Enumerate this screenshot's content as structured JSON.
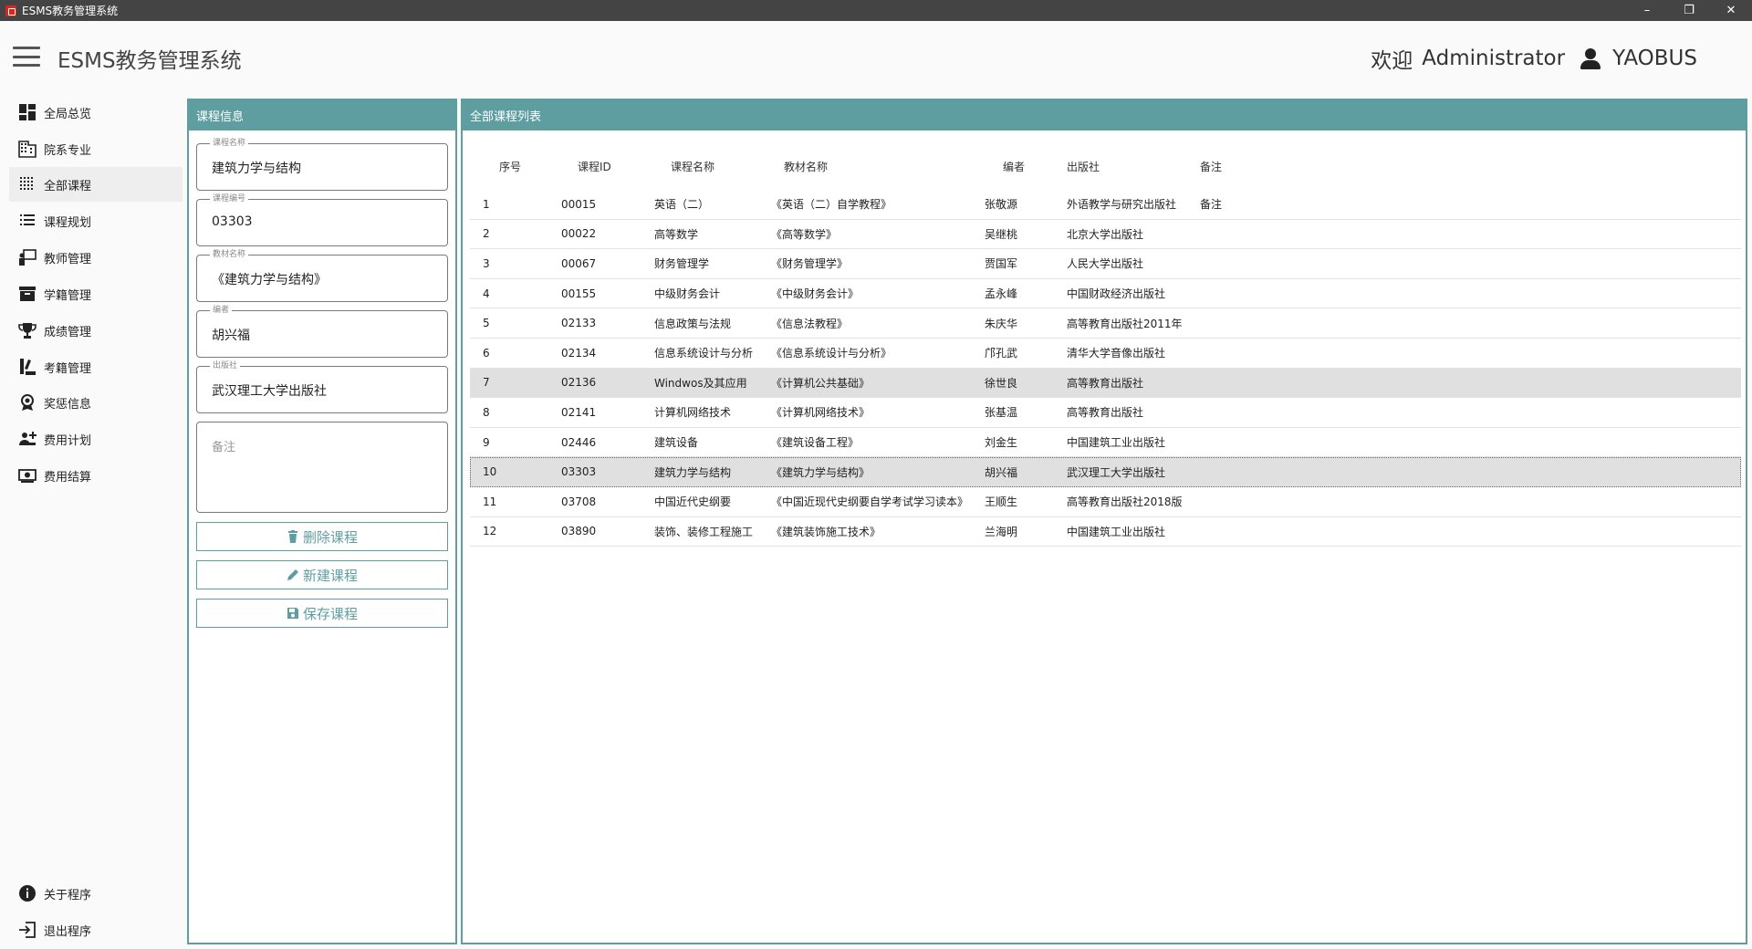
{
  "window": {
    "title": "ESMS教务管理系统",
    "minimize": "–",
    "restore": "❐",
    "close": "✕"
  },
  "header": {
    "app_title": "ESMS教务管理系统",
    "welcome": "欢迎",
    "user_name": "Administrator",
    "host_name": "YAOBUS"
  },
  "sidebar": {
    "items": [
      {
        "label": "全局总览",
        "icon": "dashboard-icon"
      },
      {
        "label": "院系专业",
        "icon": "building-icon"
      },
      {
        "label": "全部课程",
        "icon": "grid-dots-icon",
        "active": true
      },
      {
        "label": "课程规划",
        "icon": "list-icon"
      },
      {
        "label": "教师管理",
        "icon": "teacher-icon"
      },
      {
        "label": "学籍管理",
        "icon": "archive-icon"
      },
      {
        "label": "成绩管理",
        "icon": "trophy-icon"
      },
      {
        "label": "考籍管理",
        "icon": "exam-icon"
      },
      {
        "label": "奖惩信息",
        "icon": "award-icon"
      },
      {
        "label": "费用计划",
        "icon": "cost-plan-icon"
      },
      {
        "label": "费用结算",
        "icon": "money-icon"
      }
    ],
    "bottom_items": [
      {
        "label": "关于程序",
        "icon": "info-icon"
      },
      {
        "label": "退出程序",
        "icon": "exit-icon"
      }
    ]
  },
  "course_info": {
    "title": "课程信息",
    "fields": [
      {
        "label": "课程名称",
        "value": "建筑力学与结构"
      },
      {
        "label": "课程编号",
        "value": "03303"
      },
      {
        "label": "教材名称",
        "value": "《建筑力学与结构》"
      },
      {
        "label": "编者",
        "value": "胡兴福"
      },
      {
        "label": "出版社",
        "value": "武汉理工大学出版社"
      }
    ],
    "memo_placeholder": "备注",
    "buttons": {
      "delete": "删除课程",
      "new": "新建课程",
      "save": "保存课程"
    }
  },
  "course_list": {
    "title": "全部课程列表",
    "columns": [
      "序号",
      "课程ID",
      "课程名称",
      "教材名称",
      "编者",
      "出版社",
      "备注"
    ],
    "rows": [
      {
        "idx": "1",
        "id": "00015",
        "name": "英语（二）",
        "book": "《英语（二）自学教程》",
        "author": "张敬源",
        "publisher": "外语教学与研究出版社",
        "memo": "备注"
      },
      {
        "idx": "2",
        "id": "00022",
        "name": "高等数学",
        "book": "《高等数学》",
        "author": "吴继桃",
        "publisher": "北京大学出版社",
        "memo": ""
      },
      {
        "idx": "3",
        "id": "00067",
        "name": "财务管理学",
        "book": "《财务管理学》",
        "author": "贾国军",
        "publisher": "人民大学出版社",
        "memo": ""
      },
      {
        "idx": "4",
        "id": "00155",
        "name": "中级财务会计",
        "book": "《中级财务会计》",
        "author": "孟永峰",
        "publisher": "中国财政经济出版社",
        "memo": ""
      },
      {
        "idx": "5",
        "id": "02133",
        "name": "信息政策与法规",
        "book": "《信息法教程》",
        "author": "朱庆华",
        "publisher": "高等教育出版社2011年",
        "memo": ""
      },
      {
        "idx": "6",
        "id": "02134",
        "name": "信息系统设计与分析",
        "book": "《信息系统设计与分析》",
        "author": "邝孔武",
        "publisher": "清华大学音像出版社",
        "memo": ""
      },
      {
        "idx": "7",
        "id": "02136",
        "name": "Windwos及其应用",
        "book": "《计算机公共基础》",
        "author": "徐世良",
        "publisher": "高等教育出版社",
        "memo": ""
      },
      {
        "idx": "8",
        "id": "02141",
        "name": "计算机网络技术",
        "book": "《计算机网络技术》",
        "author": "张基温",
        "publisher": "高等教育出版社",
        "memo": ""
      },
      {
        "idx": "9",
        "id": "02446",
        "name": "建筑设备",
        "book": "《建筑设备工程》",
        "author": "刘金生",
        "publisher": "中国建筑工业出版社",
        "memo": ""
      },
      {
        "idx": "10",
        "id": "03303",
        "name": "建筑力学与结构",
        "book": "《建筑力学与结构》",
        "author": "胡兴福",
        "publisher": "武汉理工大学出版社",
        "memo": ""
      },
      {
        "idx": "11",
        "id": "03708",
        "name": "中国近代史纲要",
        "book": "《中国近现代史纲要自学考试学习读本》",
        "author": "王顺生",
        "publisher": "高等教育出版社2018版",
        "memo": ""
      },
      {
        "idx": "12",
        "id": "03890",
        "name": "装饰、装修工程施工",
        "book": "《建筑装饰施工技术》",
        "author": "兰海明",
        "publisher": "中国建筑工业出版社",
        "memo": ""
      }
    ],
    "hover_row": 6,
    "selected_row": 9
  },
  "colors": {
    "accent": "#5f9ea0",
    "titlebar": "#444444"
  }
}
